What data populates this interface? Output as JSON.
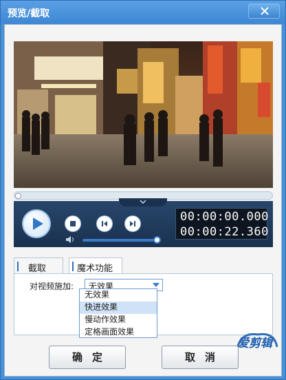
{
  "window": {
    "title": "预览/截取",
    "close_icon": "close-icon"
  },
  "player": {
    "current_time": "00:00:00.000",
    "total_time": "00:00:22.360",
    "progress": 0.0,
    "volume": 1.0,
    "icons": [
      "play-icon",
      "stop-icon",
      "previous-frame-icon",
      "next-frame-icon",
      "volume-icon",
      "chevron-down-icon"
    ]
  },
  "tabs": [
    {
      "label": "截取",
      "active": false
    },
    {
      "label": "魔术功能",
      "active": true
    }
  ],
  "magic": {
    "field_label": "对视频施加:",
    "selected": "无效果",
    "options": [
      "无效果",
      "快进效果",
      "慢动作效果",
      "定格画面效果"
    ],
    "highlighted_option": "快进效果"
  },
  "buttons": {
    "ok": "确定",
    "cancel": "取消"
  },
  "brand": {
    "logo_text": "爱剪辑"
  },
  "colors": {
    "titlebar": "#3d86d2",
    "controls_bg": "#1a3150",
    "accent": "#2f6fba",
    "highlight": "#cfe2f6"
  }
}
